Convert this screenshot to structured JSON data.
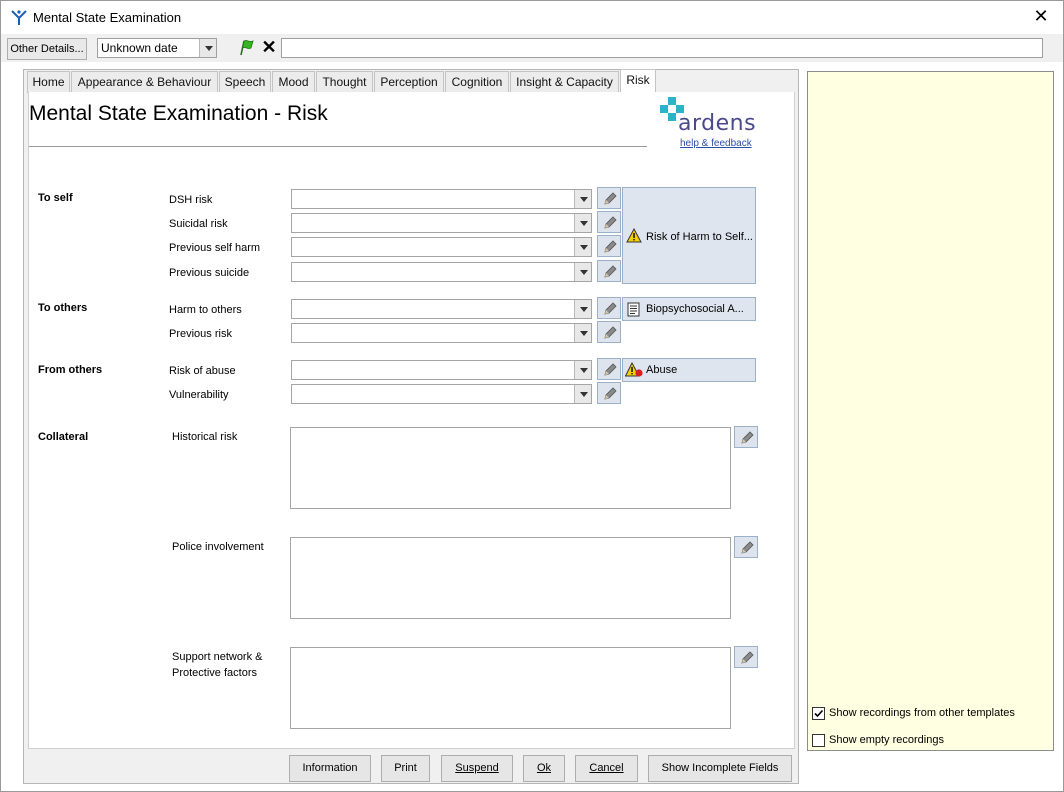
{
  "window": {
    "title": "Mental State Examination",
    "close_glyph": "✕"
  },
  "toolbar": {
    "other_details_label": "Other Details...",
    "date_value": "Unknown date",
    "clear_glyph": "✕",
    "free_text": ""
  },
  "tabs": [
    {
      "label": "Home"
    },
    {
      "label": "Appearance & Behaviour"
    },
    {
      "label": "Speech"
    },
    {
      "label": "Mood"
    },
    {
      "label": "Thought"
    },
    {
      "label": "Perception"
    },
    {
      "label": "Cognition"
    },
    {
      "label": "Insight & Capacity"
    },
    {
      "label": "Risk",
      "active": true
    }
  ],
  "page": {
    "title": "Mental State Examination - Risk",
    "logo_text": "ardens",
    "help_link": "help & feedback"
  },
  "sections": {
    "to_self": {
      "label": "To self",
      "fields": [
        "DSH risk",
        "Suicidal risk",
        "Previous self harm",
        "Previous suicide"
      ],
      "side_button": "Risk of Harm to Self..."
    },
    "to_others": {
      "label": "To others",
      "fields": [
        "Harm to others",
        "Previous risk"
      ],
      "side_button": "Biopsychosocial A..."
    },
    "from_others": {
      "label": "From others",
      "fields": [
        "Risk of abuse",
        "Vulnerability"
      ],
      "side_button": "Abuse"
    },
    "collateral": {
      "label": "Collateral",
      "fields": [
        "Historical risk",
        "Police involvement",
        "Support network &",
        "Protective factors"
      ]
    }
  },
  "bottom_buttons": {
    "information": "Information",
    "print": "Print",
    "suspend": "Suspend",
    "ok": "Ok",
    "cancel": "Cancel",
    "show_incomplete": "Show Incomplete Fields"
  },
  "right_panel": {
    "show_other_templates": {
      "label": "Show recordings from other templates",
      "checked": true
    },
    "show_empty": {
      "label": "Show empty recordings",
      "checked": false
    }
  },
  "colors": {
    "right_panel_bg": "#ffffe1",
    "logo_cross": "#2bb3c9",
    "link": "#2a4fa8"
  }
}
